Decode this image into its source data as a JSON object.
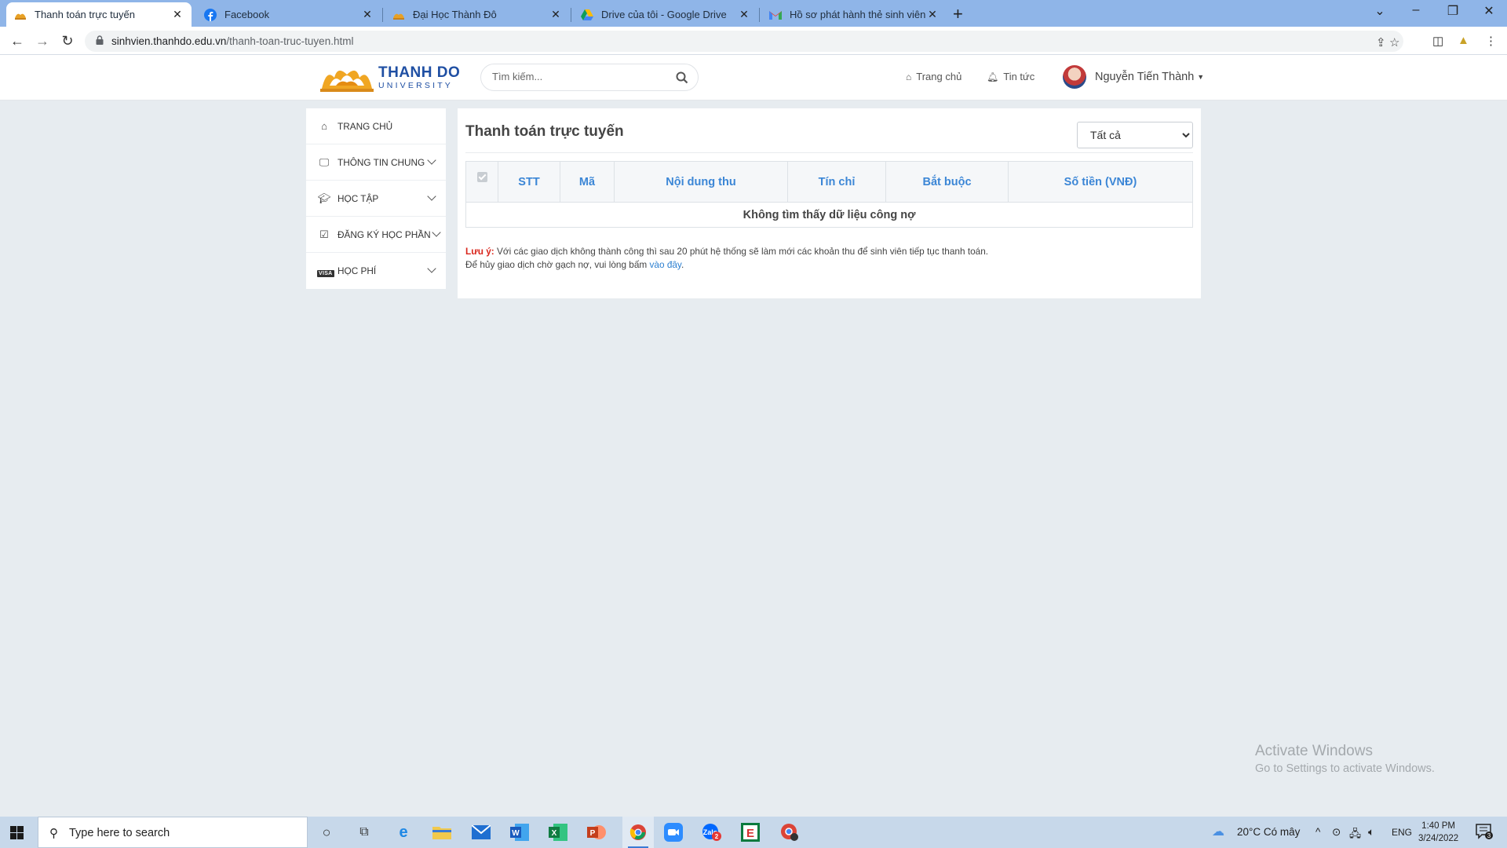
{
  "browser": {
    "tabs": [
      {
        "title": "Thanh toán trực tuyến",
        "icon": "thanhdo-logo-icon",
        "active": true
      },
      {
        "title": "Facebook",
        "icon": "facebook-icon",
        "active": false
      },
      {
        "title": "Đại Học Thành Đô",
        "icon": "thanhdo-logo-icon",
        "active": false
      },
      {
        "title": "Drive của tôi - Google Drive",
        "icon": "google-drive-icon",
        "active": false
      },
      {
        "title": "Hồ sơ phát hành thẻ sinh viên liê",
        "icon": "gmail-icon",
        "active": false
      }
    ],
    "url_host": "sinhvien.thanhdo.edu.vn",
    "url_path": "/thanh-toan-truc-tuyen.html"
  },
  "header": {
    "logo_line1": "THANH DO",
    "logo_line2": "UNIVERSITY",
    "search_placeholder": "Tìm kiếm...",
    "nav_home": "Trang chủ",
    "nav_news": "Tin tức",
    "user_name": "Nguyễn Tiến Thành"
  },
  "sidebar": {
    "items": [
      {
        "label": "TRANG CHỦ",
        "icon": "home-icon"
      },
      {
        "label": "THÔNG TIN CHUNG",
        "icon": "monitor-icon"
      },
      {
        "label": "HỌC TẬP",
        "icon": "graduation-cap-icon"
      },
      {
        "label": "ĐĂNG KÝ HỌC PHẦN",
        "icon": "check-square-icon"
      },
      {
        "label": "HỌC PHÍ",
        "icon": "visa-card-icon"
      }
    ]
  },
  "main": {
    "title": "Thanh toán trực tuyến",
    "filter_selected": "Tất cả",
    "table": {
      "columns": [
        "STT",
        "Mã",
        "Nội dung thu",
        "Tín chỉ",
        "Bắt buộc",
        "Số tiền (VNĐ)"
      ],
      "empty_message": "Không tìm thấy dữ liệu công nợ"
    },
    "note_label": "Lưu ý:",
    "note_text": " Với các giao dịch không thành công thì sau 20 phút hệ thống sẽ làm mới các khoản thu để sinh viên tiếp tục thanh toán.",
    "note_line2": "Để hủy giao dịch chờ gạch nợ, vui lòng bấm ",
    "note_link": "vào đây",
    "note_end": "."
  },
  "watermark": {
    "line1": "Activate Windows",
    "line2": "Go to Settings to activate Windows."
  },
  "taskbar": {
    "search_placeholder": "Type here to search",
    "weather": "20°C  Có mây",
    "lang": "ENG",
    "time": "1:40 PM",
    "date": "3/24/2022",
    "notification_count": "3",
    "zalo_badge": "2"
  },
  "colors": {
    "accent_blue": "#3b86d6",
    "warning_red": "#d9261c",
    "tabbar": "#8fb5e8",
    "page_bg": "#e7ecf0"
  }
}
